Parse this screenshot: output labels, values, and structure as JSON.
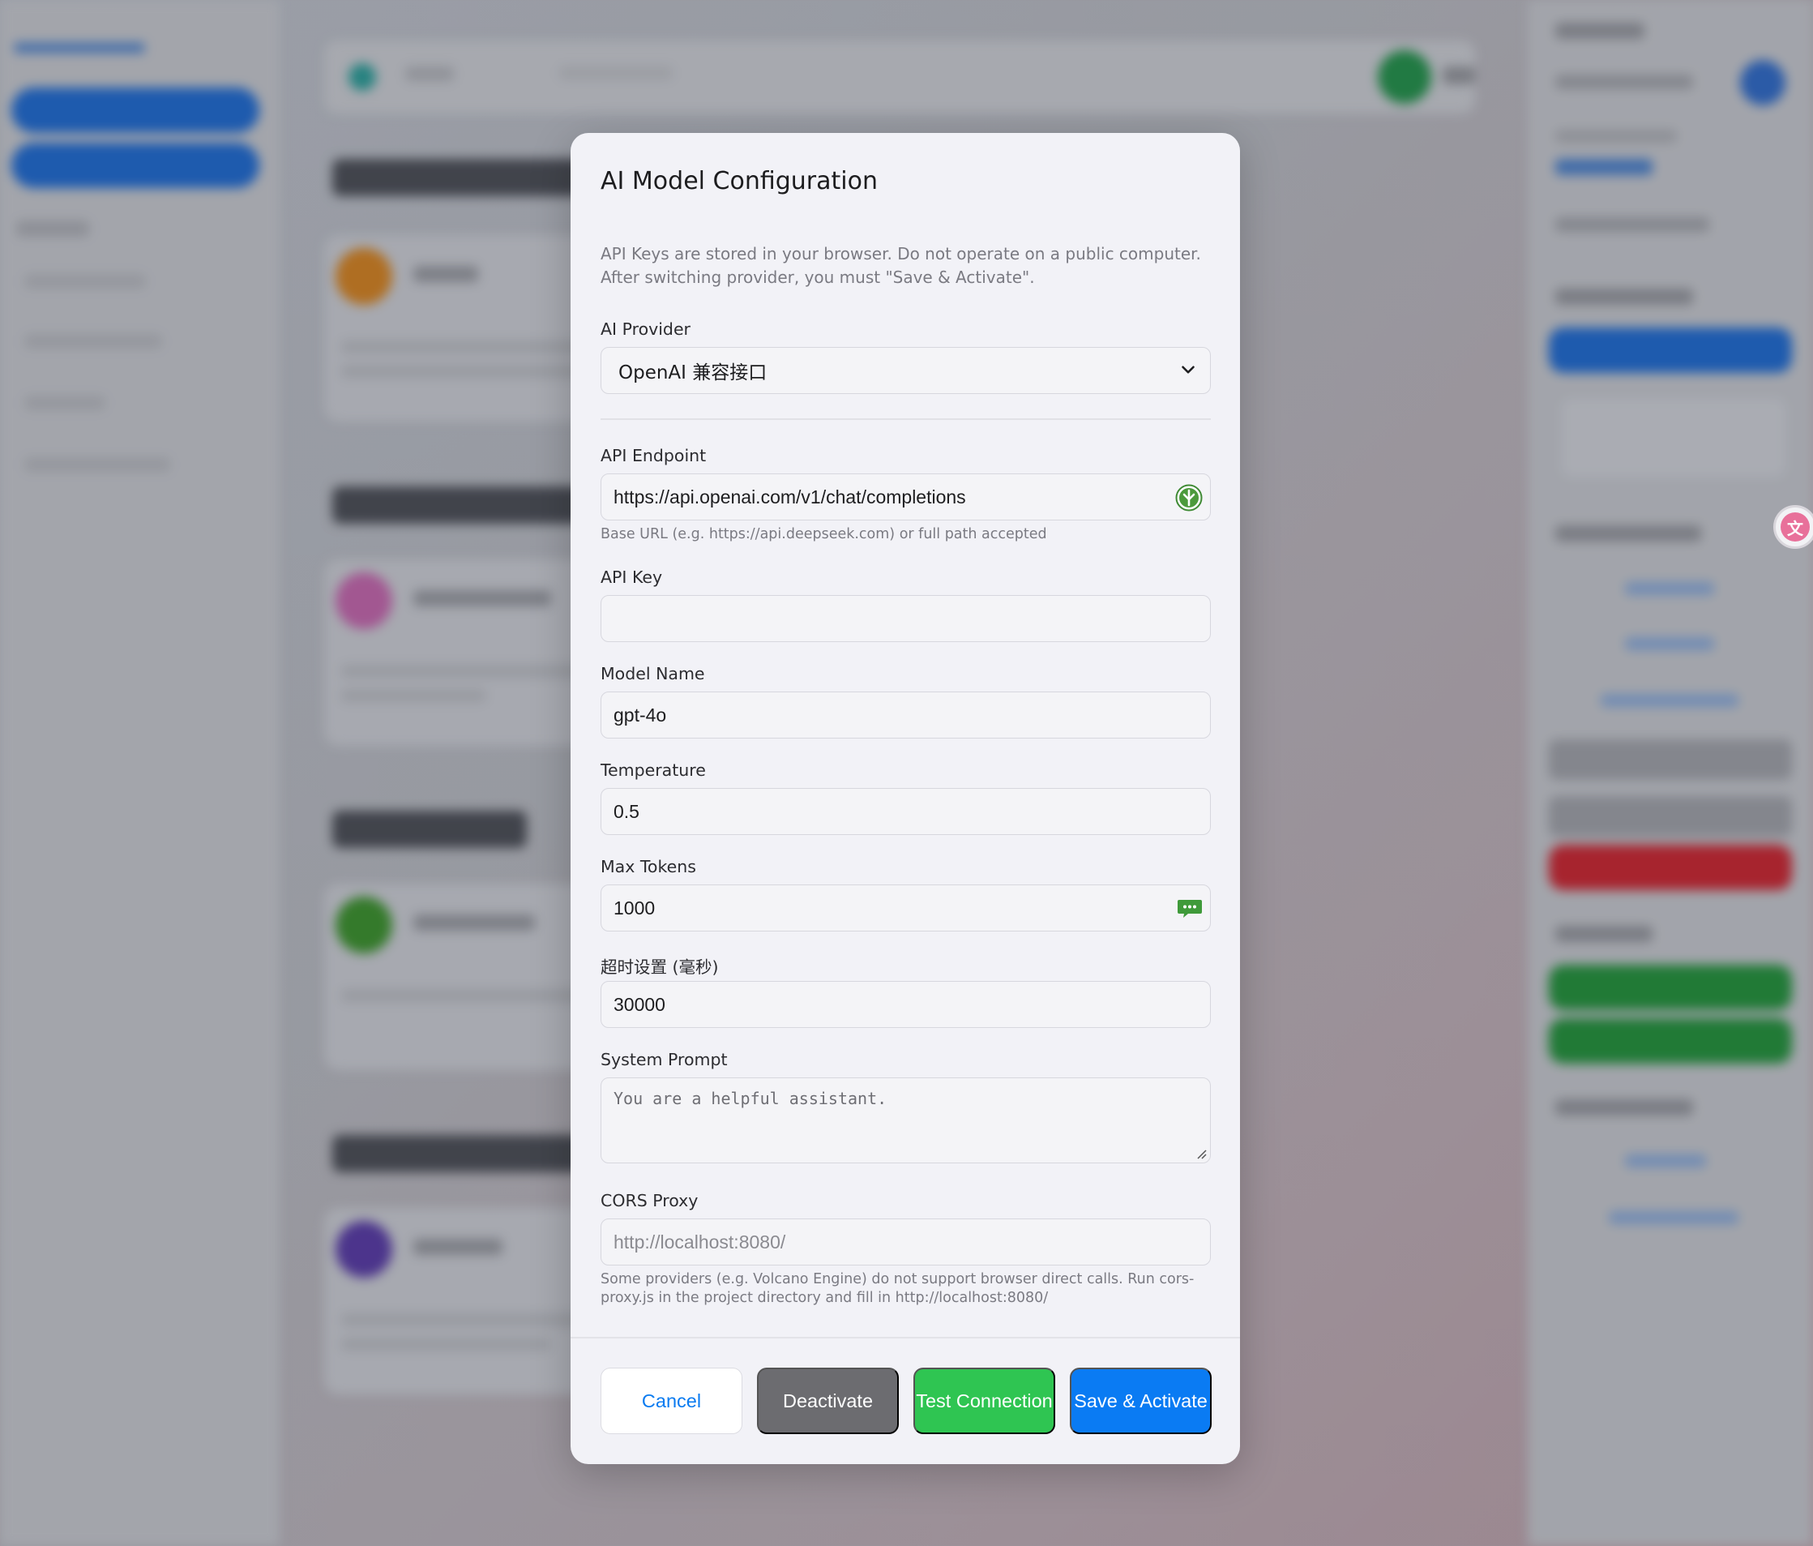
{
  "modal": {
    "title": "AI Model Configuration",
    "description": "API Keys are stored in your browser. Do not operate on a public computer. After switching provider, you must \"Save & Activate\".",
    "provider": {
      "label": "AI Provider",
      "selected": "OpenAI 兼容接口"
    },
    "endpoint": {
      "label": "API Endpoint",
      "value": "https://api.openai.com/v1/chat/completions",
      "hint": "Base URL (e.g. https://api.deepseek.com) or full path accepted"
    },
    "api_key": {
      "label": "API Key",
      "value": ""
    },
    "model_name": {
      "label": "Model Name",
      "value": "gpt-4o"
    },
    "temperature": {
      "label": "Temperature",
      "value": "0.5"
    },
    "max_tokens": {
      "label": "Max Tokens",
      "value": "1000"
    },
    "timeout": {
      "label": "超时设置 (毫秒)",
      "value": "30000"
    },
    "system_prompt": {
      "label": "System Prompt",
      "value": "You are a helpful assistant."
    },
    "cors_proxy": {
      "label": "CORS Proxy",
      "placeholder": "http://localhost:8080/",
      "hint": "Some providers (e.g. Volcano Engine) do not support browser direct calls. Run cors-proxy.js in the project directory and fill in http://localhost:8080/"
    },
    "buttons": {
      "cancel": "Cancel",
      "deactivate": "Deactivate",
      "test": "Test Connection",
      "save": "Save & Activate"
    }
  },
  "colors": {
    "primary": "#0a7bf3",
    "success": "#2fc552",
    "neutral": "#6c6c70"
  },
  "icons": {
    "endpoint_field": "browser-extension-icon",
    "max_tokens_field": "password-manager-icon",
    "select": "chevron-down-icon",
    "side_badge": "translate-icon"
  }
}
